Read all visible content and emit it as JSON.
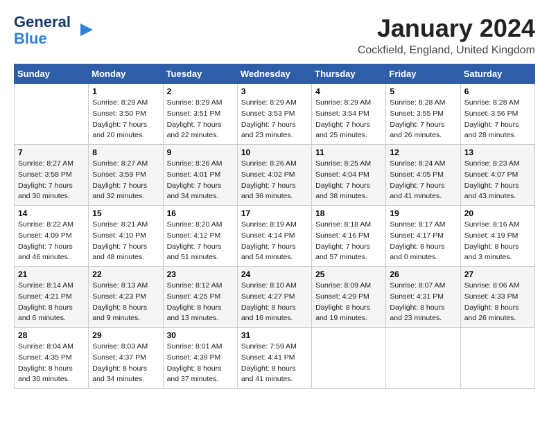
{
  "header": {
    "logo_general": "General",
    "logo_blue": "Blue",
    "month_title": "January 2024",
    "location": "Cockfield, England, United Kingdom"
  },
  "days_of_week": [
    "Sunday",
    "Monday",
    "Tuesday",
    "Wednesday",
    "Thursday",
    "Friday",
    "Saturday"
  ],
  "weeks": [
    [
      {
        "day": "",
        "sunrise": "",
        "sunset": "",
        "daylight": ""
      },
      {
        "day": "1",
        "sunrise": "Sunrise: 8:29 AM",
        "sunset": "Sunset: 3:50 PM",
        "daylight": "Daylight: 7 hours and 20 minutes."
      },
      {
        "day": "2",
        "sunrise": "Sunrise: 8:29 AM",
        "sunset": "Sunset: 3:51 PM",
        "daylight": "Daylight: 7 hours and 22 minutes."
      },
      {
        "day": "3",
        "sunrise": "Sunrise: 8:29 AM",
        "sunset": "Sunset: 3:53 PM",
        "daylight": "Daylight: 7 hours and 23 minutes."
      },
      {
        "day": "4",
        "sunrise": "Sunrise: 8:29 AM",
        "sunset": "Sunset: 3:54 PM",
        "daylight": "Daylight: 7 hours and 25 minutes."
      },
      {
        "day": "5",
        "sunrise": "Sunrise: 8:28 AM",
        "sunset": "Sunset: 3:55 PM",
        "daylight": "Daylight: 7 hours and 26 minutes."
      },
      {
        "day": "6",
        "sunrise": "Sunrise: 8:28 AM",
        "sunset": "Sunset: 3:56 PM",
        "daylight": "Daylight: 7 hours and 28 minutes."
      }
    ],
    [
      {
        "day": "7",
        "sunrise": "Sunrise: 8:27 AM",
        "sunset": "Sunset: 3:58 PM",
        "daylight": "Daylight: 7 hours and 30 minutes."
      },
      {
        "day": "8",
        "sunrise": "Sunrise: 8:27 AM",
        "sunset": "Sunset: 3:59 PM",
        "daylight": "Daylight: 7 hours and 32 minutes."
      },
      {
        "day": "9",
        "sunrise": "Sunrise: 8:26 AM",
        "sunset": "Sunset: 4:01 PM",
        "daylight": "Daylight: 7 hours and 34 minutes."
      },
      {
        "day": "10",
        "sunrise": "Sunrise: 8:26 AM",
        "sunset": "Sunset: 4:02 PM",
        "daylight": "Daylight: 7 hours and 36 minutes."
      },
      {
        "day": "11",
        "sunrise": "Sunrise: 8:25 AM",
        "sunset": "Sunset: 4:04 PM",
        "daylight": "Daylight: 7 hours and 38 minutes."
      },
      {
        "day": "12",
        "sunrise": "Sunrise: 8:24 AM",
        "sunset": "Sunset: 4:05 PM",
        "daylight": "Daylight: 7 hours and 41 minutes."
      },
      {
        "day": "13",
        "sunrise": "Sunrise: 8:23 AM",
        "sunset": "Sunset: 4:07 PM",
        "daylight": "Daylight: 7 hours and 43 minutes."
      }
    ],
    [
      {
        "day": "14",
        "sunrise": "Sunrise: 8:22 AM",
        "sunset": "Sunset: 4:09 PM",
        "daylight": "Daylight: 7 hours and 46 minutes."
      },
      {
        "day": "15",
        "sunrise": "Sunrise: 8:21 AM",
        "sunset": "Sunset: 4:10 PM",
        "daylight": "Daylight: 7 hours and 48 minutes."
      },
      {
        "day": "16",
        "sunrise": "Sunrise: 8:20 AM",
        "sunset": "Sunset: 4:12 PM",
        "daylight": "Daylight: 7 hours and 51 minutes."
      },
      {
        "day": "17",
        "sunrise": "Sunrise: 8:19 AM",
        "sunset": "Sunset: 4:14 PM",
        "daylight": "Daylight: 7 hours and 54 minutes."
      },
      {
        "day": "18",
        "sunrise": "Sunrise: 8:18 AM",
        "sunset": "Sunset: 4:16 PM",
        "daylight": "Daylight: 7 hours and 57 minutes."
      },
      {
        "day": "19",
        "sunrise": "Sunrise: 8:17 AM",
        "sunset": "Sunset: 4:17 PM",
        "daylight": "Daylight: 8 hours and 0 minutes."
      },
      {
        "day": "20",
        "sunrise": "Sunrise: 8:16 AM",
        "sunset": "Sunset: 4:19 PM",
        "daylight": "Daylight: 8 hours and 3 minutes."
      }
    ],
    [
      {
        "day": "21",
        "sunrise": "Sunrise: 8:14 AM",
        "sunset": "Sunset: 4:21 PM",
        "daylight": "Daylight: 8 hours and 6 minutes."
      },
      {
        "day": "22",
        "sunrise": "Sunrise: 8:13 AM",
        "sunset": "Sunset: 4:23 PM",
        "daylight": "Daylight: 8 hours and 9 minutes."
      },
      {
        "day": "23",
        "sunrise": "Sunrise: 8:12 AM",
        "sunset": "Sunset: 4:25 PM",
        "daylight": "Daylight: 8 hours and 13 minutes."
      },
      {
        "day": "24",
        "sunrise": "Sunrise: 8:10 AM",
        "sunset": "Sunset: 4:27 PM",
        "daylight": "Daylight: 8 hours and 16 minutes."
      },
      {
        "day": "25",
        "sunrise": "Sunrise: 8:09 AM",
        "sunset": "Sunset: 4:29 PM",
        "daylight": "Daylight: 8 hours and 19 minutes."
      },
      {
        "day": "26",
        "sunrise": "Sunrise: 8:07 AM",
        "sunset": "Sunset: 4:31 PM",
        "daylight": "Daylight: 8 hours and 23 minutes."
      },
      {
        "day": "27",
        "sunrise": "Sunrise: 8:06 AM",
        "sunset": "Sunset: 4:33 PM",
        "daylight": "Daylight: 8 hours and 26 minutes."
      }
    ],
    [
      {
        "day": "28",
        "sunrise": "Sunrise: 8:04 AM",
        "sunset": "Sunset: 4:35 PM",
        "daylight": "Daylight: 8 hours and 30 minutes."
      },
      {
        "day": "29",
        "sunrise": "Sunrise: 8:03 AM",
        "sunset": "Sunset: 4:37 PM",
        "daylight": "Daylight: 8 hours and 34 minutes."
      },
      {
        "day": "30",
        "sunrise": "Sunrise: 8:01 AM",
        "sunset": "Sunset: 4:39 PM",
        "daylight": "Daylight: 8 hours and 37 minutes."
      },
      {
        "day": "31",
        "sunrise": "Sunrise: 7:59 AM",
        "sunset": "Sunset: 4:41 PM",
        "daylight": "Daylight: 8 hours and 41 minutes."
      },
      {
        "day": "",
        "sunrise": "",
        "sunset": "",
        "daylight": ""
      },
      {
        "day": "",
        "sunrise": "",
        "sunset": "",
        "daylight": ""
      },
      {
        "day": "",
        "sunrise": "",
        "sunset": "",
        "daylight": ""
      }
    ]
  ]
}
